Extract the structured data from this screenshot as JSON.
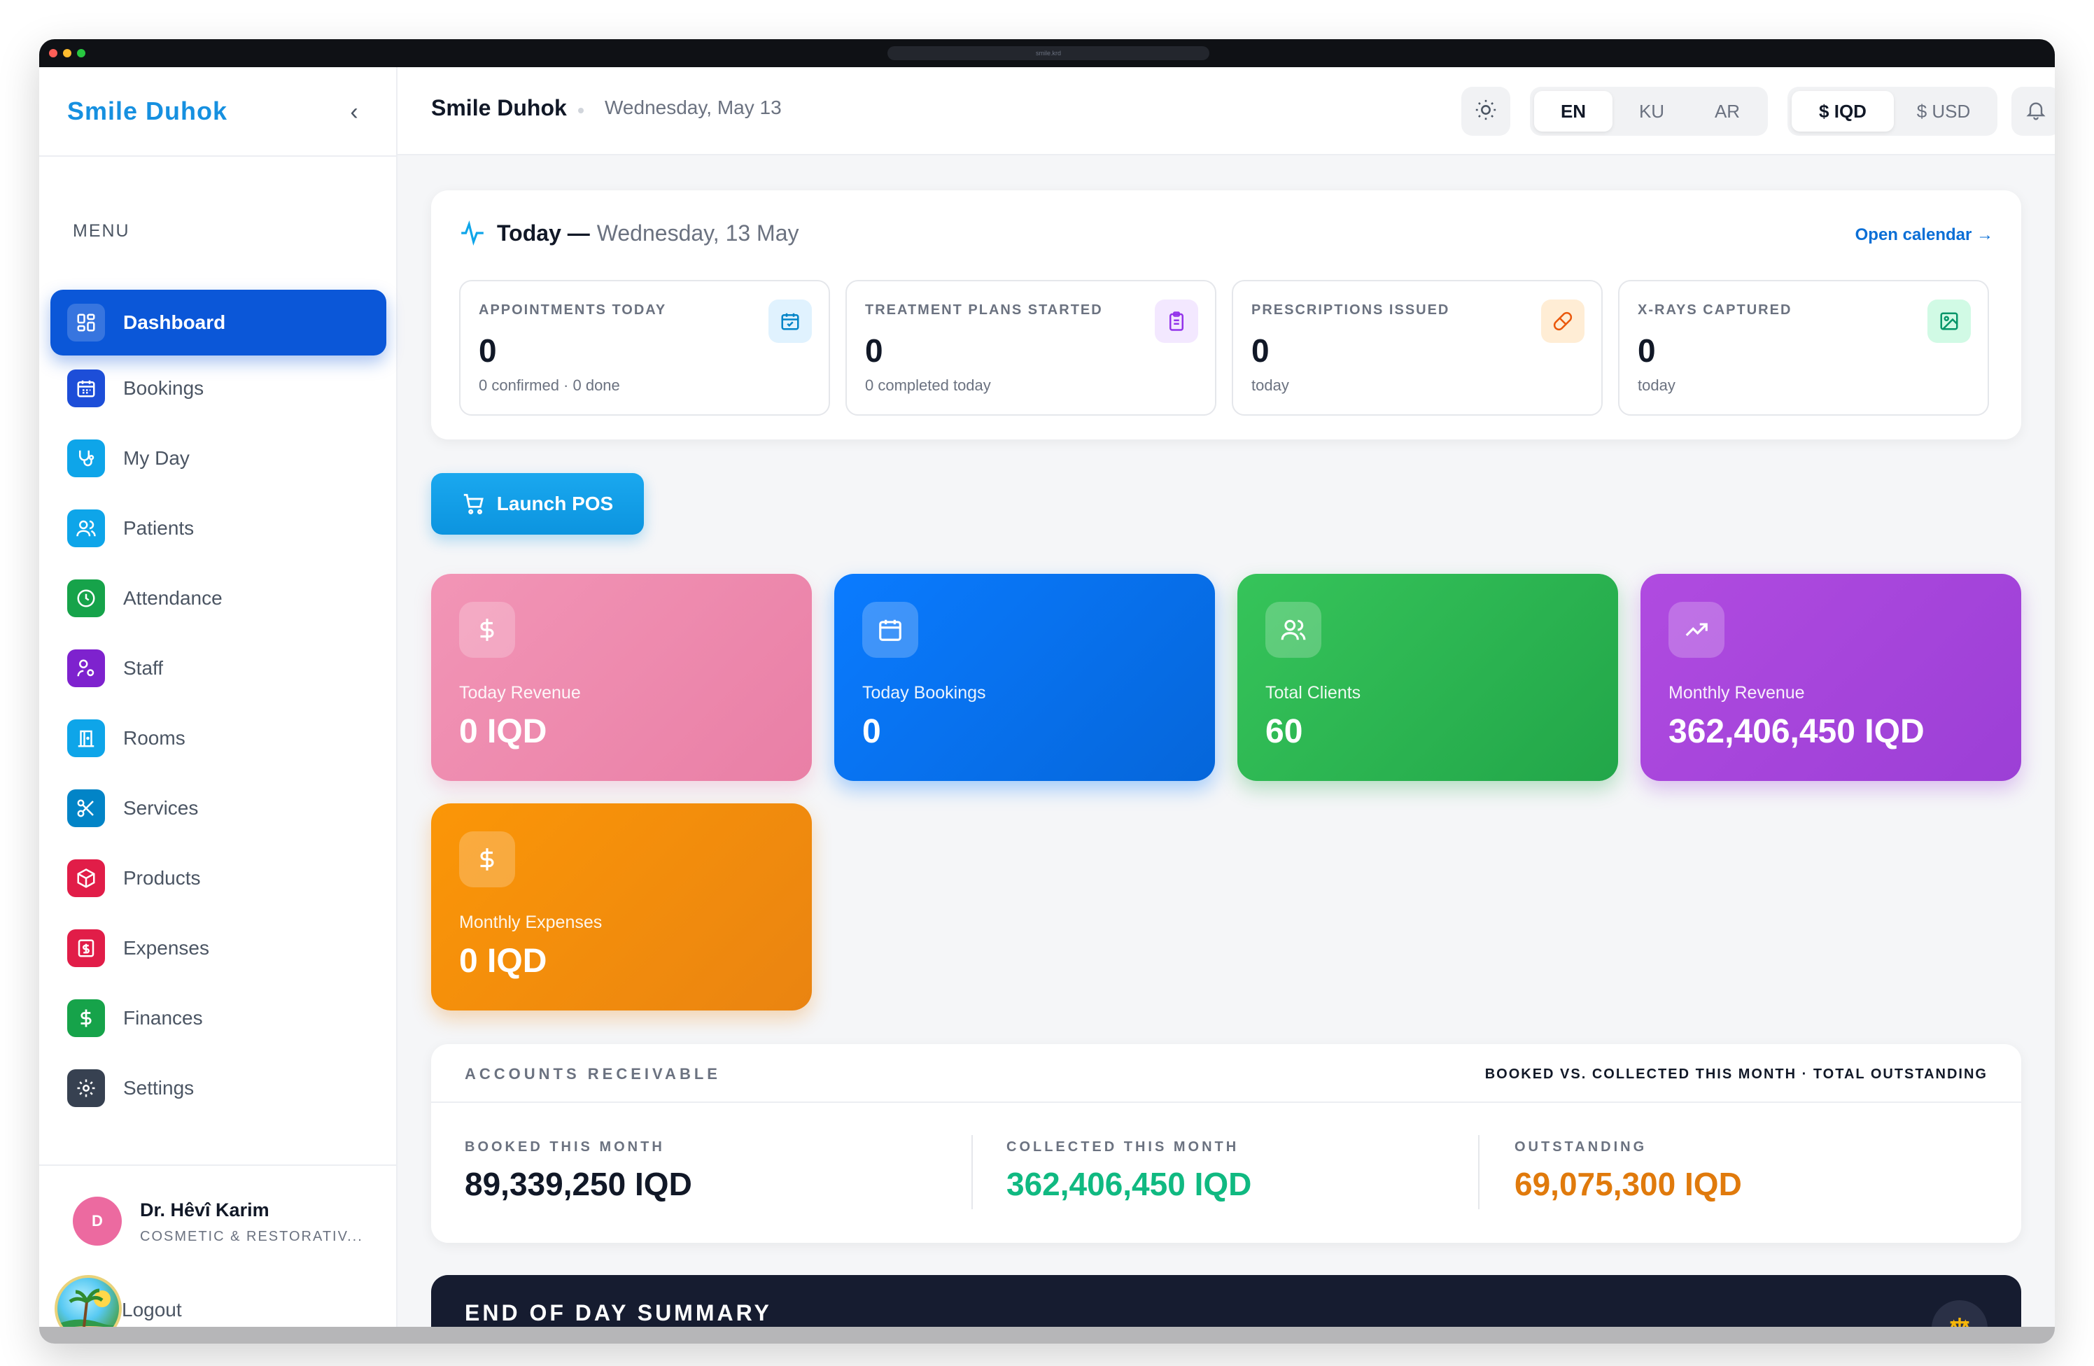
{
  "window": {
    "url": "smile.krd"
  },
  "sidebar": {
    "brand": "Smile Duhok",
    "menu_label": "MENU",
    "items": [
      {
        "label": "Dashboard",
        "icon": "dashboard-grid-icon",
        "color": "#0b57d8"
      },
      {
        "label": "Bookings",
        "icon": "calendar-icon",
        "color": "#1d4ed8"
      },
      {
        "label": "My Day",
        "icon": "stethoscope-icon",
        "color": "#0ea5e9"
      },
      {
        "label": "Patients",
        "icon": "users-icon",
        "color": "#0ea5e9"
      },
      {
        "label": "Attendance",
        "icon": "clock-icon",
        "color": "#16a34a"
      },
      {
        "label": "Staff",
        "icon": "user-cog-icon",
        "color": "#7e22ce"
      },
      {
        "label": "Rooms",
        "icon": "door-icon",
        "color": "#0ea5e9"
      },
      {
        "label": "Services",
        "icon": "scissors-icon",
        "color": "#0284c7"
      },
      {
        "label": "Products",
        "icon": "box-icon",
        "color": "#e11d48"
      },
      {
        "label": "Expenses",
        "icon": "receipt-icon",
        "color": "#e11d48"
      },
      {
        "label": "Finances",
        "icon": "dollar-icon",
        "color": "#16a34a"
      },
      {
        "label": "Settings",
        "icon": "gear-icon",
        "color": "#374151"
      }
    ],
    "user": {
      "initial": "D",
      "name": "Dr. Hêvî Karim",
      "role": "COSMETIC & RESTORATIV..."
    },
    "logout_label": "Logout"
  },
  "header": {
    "title": "Smile Duhok",
    "date": "Wednesday, May 13",
    "languages": [
      "EN",
      "KU",
      "AR"
    ],
    "active_language": "EN",
    "currencies": [
      "$ IQD",
      "$ USD"
    ],
    "active_currency": "$ IQD"
  },
  "today": {
    "label": "Today —",
    "date": "Wednesday, 13 May",
    "open_calendar": "Open calendar →",
    "stats": [
      {
        "title": "APPOINTMENTS TODAY",
        "value": "0",
        "sub": "0 confirmed · 0 done",
        "icon": "calendar-check-icon",
        "color": "#0284c7"
      },
      {
        "title": "TREATMENT PLANS STARTED",
        "value": "0",
        "sub": "0 completed today",
        "icon": "clipboard-icon",
        "color": "#9333ea"
      },
      {
        "title": "PRESCRIPTIONS ISSUED",
        "value": "0",
        "sub": "today",
        "icon": "pill-icon",
        "color": "#ea580c"
      },
      {
        "title": "X-RAYS CAPTURED",
        "value": "0",
        "sub": "today",
        "icon": "image-icon",
        "color": "#059669"
      }
    ]
  },
  "pos_button": "Launch POS",
  "kpis": [
    {
      "label": "Today Revenue",
      "value": "0 IQD",
      "icon": "dollar-icon"
    },
    {
      "label": "Today Bookings",
      "value": "0",
      "icon": "calendar-icon"
    },
    {
      "label": "Total Clients",
      "value": "60",
      "icon": "users-icon"
    },
    {
      "label": "Monthly Revenue",
      "value": "362,406,450 IQD",
      "icon": "trending-up-icon"
    },
    {
      "label": "Monthly Expenses",
      "value": "0 IQD",
      "icon": "dollar-icon"
    }
  ],
  "accounts_receivable": {
    "title": "ACCOUNTS RECEIVABLE",
    "subtitle": "BOOKED VS. COLLECTED THIS MONTH · TOTAL OUTSTANDING",
    "booked_label": "BOOKED THIS MONTH",
    "booked_value": "89,339,250 IQD",
    "collected_label": "COLLECTED THIS MONTH",
    "collected_value": "362,406,450 IQD",
    "outstanding_label": "OUTSTANDING",
    "outstanding_value": "69,075,300 IQD",
    "colors": {
      "booked": "#111827",
      "collected": "#10b981",
      "outstanding": "#e07a0c"
    }
  },
  "end_of_day": {
    "title": "END OF DAY SUMMARY",
    "icon": "scale-icon"
  }
}
